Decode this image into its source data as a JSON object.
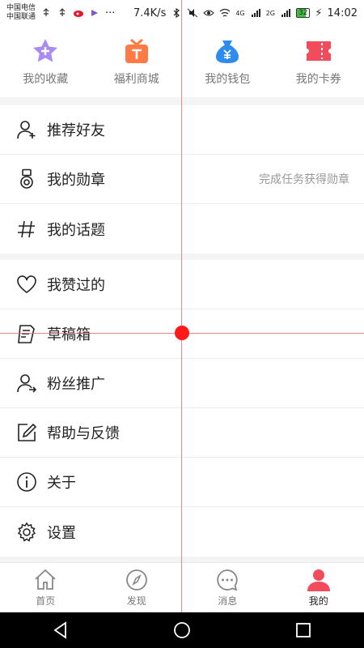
{
  "status_bar": {
    "carrier1": "中国电信",
    "carrier2": "中国联通",
    "net_speed": "7.4K/s",
    "signal1": "4G",
    "signal2": "2G",
    "battery": "32",
    "time": "14:02",
    "more": "···"
  },
  "shortcuts": [
    {
      "label": "我的收藏",
      "icon": "star-icon",
      "color": "#a98cf3"
    },
    {
      "label": "福利商城",
      "icon": "gift-icon",
      "color": "#ff7a45"
    },
    {
      "label": "我的钱包",
      "icon": "wallet-icon",
      "color": "#2e8cf0"
    },
    {
      "label": "我的卡券",
      "icon": "ticket-icon",
      "color": "#f24b5b"
    }
  ],
  "menu_group1": [
    {
      "label": "推荐好友",
      "icon": "add-user-icon"
    },
    {
      "label": "我的勋章",
      "icon": "medal-icon",
      "hint": "完成任务获得勋章"
    },
    {
      "label": "我的话题",
      "icon": "hashtag-icon"
    }
  ],
  "menu_group2": [
    {
      "label": "我赞过的",
      "icon": "heart-icon"
    },
    {
      "label": "草稿箱",
      "icon": "draft-icon"
    },
    {
      "label": "粉丝推广",
      "icon": "fan-promote-icon"
    },
    {
      "label": "帮助与反馈",
      "icon": "edit-icon"
    },
    {
      "label": "关于",
      "icon": "info-icon"
    },
    {
      "label": "设置",
      "icon": "gear-icon"
    }
  ],
  "tabs": [
    {
      "label": "首页",
      "icon": "home-icon"
    },
    {
      "label": "发现",
      "icon": "compass-icon"
    },
    {
      "label": "消息",
      "icon": "chat-icon"
    },
    {
      "label": "我的",
      "icon": "profile-icon",
      "active": true
    }
  ],
  "colors": {
    "accent": "#f24b5b",
    "background": "#f4f4f4"
  }
}
